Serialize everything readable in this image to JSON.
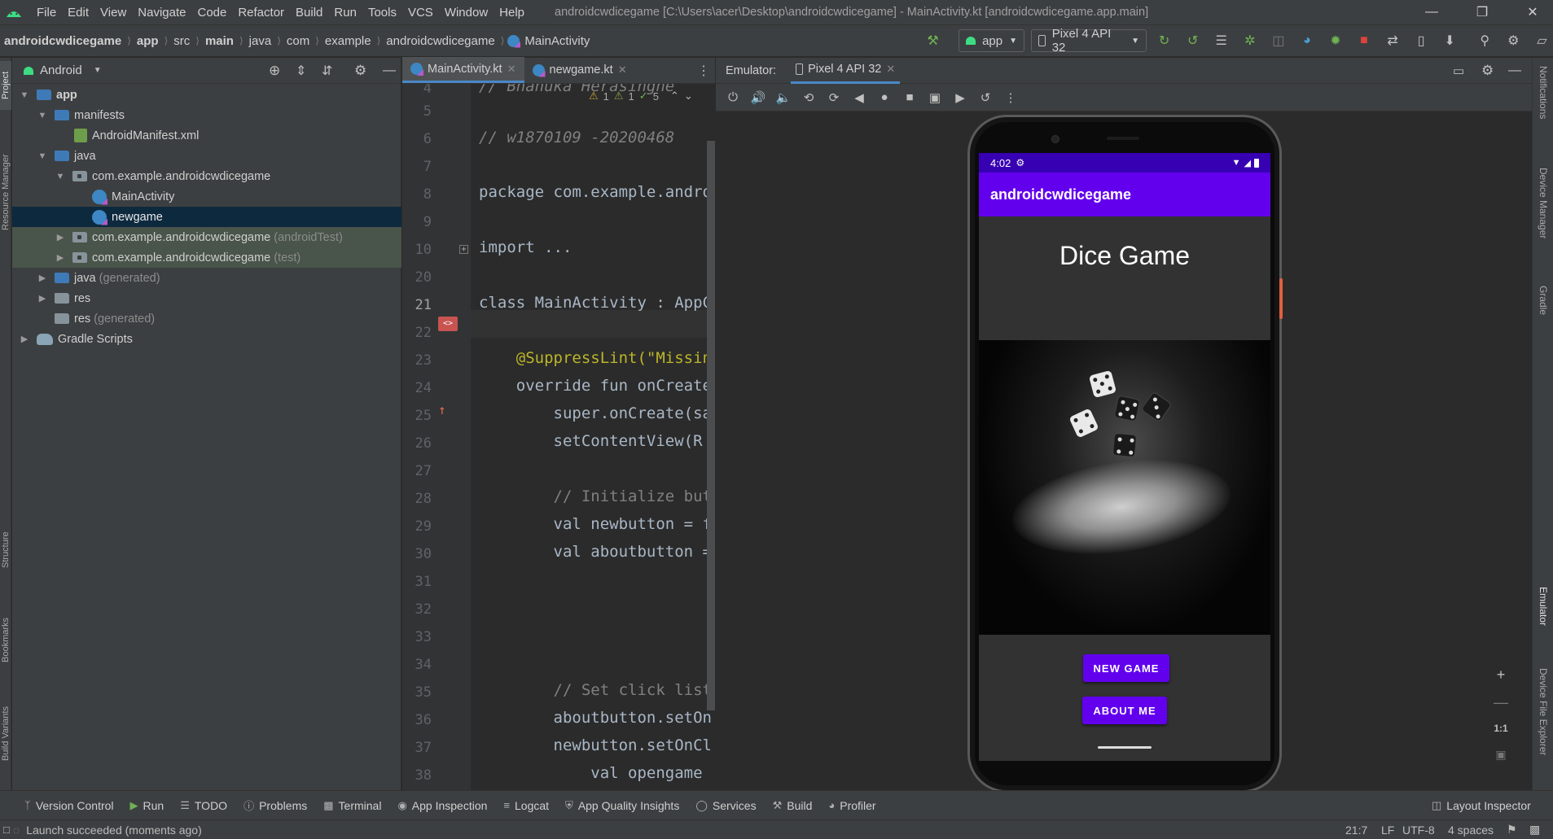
{
  "menu": {
    "items": [
      "File",
      "Edit",
      "View",
      "Navigate",
      "Code",
      "Refactor",
      "Build",
      "Run",
      "Tools",
      "VCS",
      "Window",
      "Help"
    ],
    "window_title": "androidcwdicegame [C:\\Users\\acer\\Desktop\\androidcwdicegame] - MainActivity.kt [androidcwdicegame.app.main]"
  },
  "breadcrumb": [
    "androidcwdicegame",
    "app",
    "src",
    "main",
    "java",
    "com",
    "example",
    "androidcwdicegame",
    "MainActivity"
  ],
  "toolbar": {
    "run_config": "app",
    "device": "Pixel 4 API 32"
  },
  "project": {
    "view_mode": "Android",
    "tree": [
      {
        "label": "app",
        "suffix": ""
      },
      {
        "label": "manifests",
        "suffix": ""
      },
      {
        "label": "AndroidManifest.xml",
        "suffix": ""
      },
      {
        "label": "java",
        "suffix": ""
      },
      {
        "label": "com.example.androidcwdicegame",
        "suffix": ""
      },
      {
        "label": "MainActivity",
        "suffix": ""
      },
      {
        "label": "newgame",
        "suffix": ""
      },
      {
        "label": "com.example.androidcwdicegame",
        "suffix": "(androidTest)"
      },
      {
        "label": "com.example.androidcwdicegame",
        "suffix": "(test)"
      },
      {
        "label": "java",
        "suffix": "(generated)"
      },
      {
        "label": "res",
        "suffix": ""
      },
      {
        "label": "res",
        "suffix": "(generated)"
      },
      {
        "label": "Gradle Scripts",
        "suffix": ""
      }
    ]
  },
  "editor": {
    "tabs": [
      "MainActivity.kt",
      "newgame.kt"
    ],
    "inspections": {
      "warnings": "1",
      "weak_warnings": "1",
      "typos": "5"
    },
    "lines": [
      {
        "num": "4",
        "text": "// Bhanuka Herasinghe"
      },
      {
        "num": "5",
        "text": ""
      },
      {
        "num": "6",
        "text": "// w1870109 -20200468"
      },
      {
        "num": "7",
        "text": ""
      },
      {
        "num": "8",
        "text": "package com.example.andro"
      },
      {
        "num": "9",
        "text": ""
      },
      {
        "num": "10",
        "text": "import ..."
      },
      {
        "num": "20",
        "text": ""
      },
      {
        "num": "21",
        "text": "class MainActivity : AppC"
      },
      {
        "num": "22",
        "text": ""
      },
      {
        "num": "23",
        "text": "    @SuppressLint(\"Missin"
      },
      {
        "num": "24",
        "text": "    override fun onCreate"
      },
      {
        "num": "25",
        "text": "        super.onCreate(sa"
      },
      {
        "num": "26",
        "text": "        setContentView(R"
      },
      {
        "num": "27",
        "text": ""
      },
      {
        "num": "28",
        "text": "        // Initialize but"
      },
      {
        "num": "29",
        "text": "        val newbutton = f"
      },
      {
        "num": "30",
        "text": "        val aboutbutton ="
      },
      {
        "num": "31",
        "text": ""
      },
      {
        "num": "32",
        "text": ""
      },
      {
        "num": "33",
        "text": ""
      },
      {
        "num": "34",
        "text": ""
      },
      {
        "num": "35",
        "text": "        // Set click list"
      },
      {
        "num": "36",
        "text": "        aboutbutton.setOn"
      },
      {
        "num": "37",
        "text": "        newbutton.setOnCl"
      },
      {
        "num": "38",
        "text": "            val opengame"
      }
    ]
  },
  "emulator": {
    "label": "Emulator:",
    "tab": "Pixel 4 API 32",
    "zoom_one_to_one": "1:1"
  },
  "phone": {
    "time": "4:02",
    "app_title": "androidcwdicegame",
    "heading": "Dice Game",
    "btn_new_game": "NEW GAME",
    "btn_about_me": "ABOUT ME"
  },
  "side_tabs": {
    "left": [
      "Project",
      "Resource Manager",
      "Structure",
      "Bookmarks",
      "Build Variants"
    ],
    "right": [
      "Notifications",
      "Device Manager",
      "Gradle",
      "Emulator",
      "Device File Explorer"
    ]
  },
  "bottom_tools": [
    "Version Control",
    "Run",
    "TODO",
    "Problems",
    "Terminal",
    "App Inspection",
    "Logcat",
    "App Quality Insights",
    "Services",
    "Build",
    "Profiler"
  ],
  "layout_inspector": "Layout Inspector",
  "status": {
    "message": "Launch succeeded (moments ago)",
    "position": "21:7",
    "line_sep": "LF",
    "encoding": "UTF-8",
    "indent": "4 spaces"
  },
  "colors": {
    "ide_bg": "#2b2b2b",
    "panel_bg": "#3c3f41",
    "app_primary": "#6200ee",
    "app_status": "#3700b3",
    "selection": "#0d293e"
  }
}
